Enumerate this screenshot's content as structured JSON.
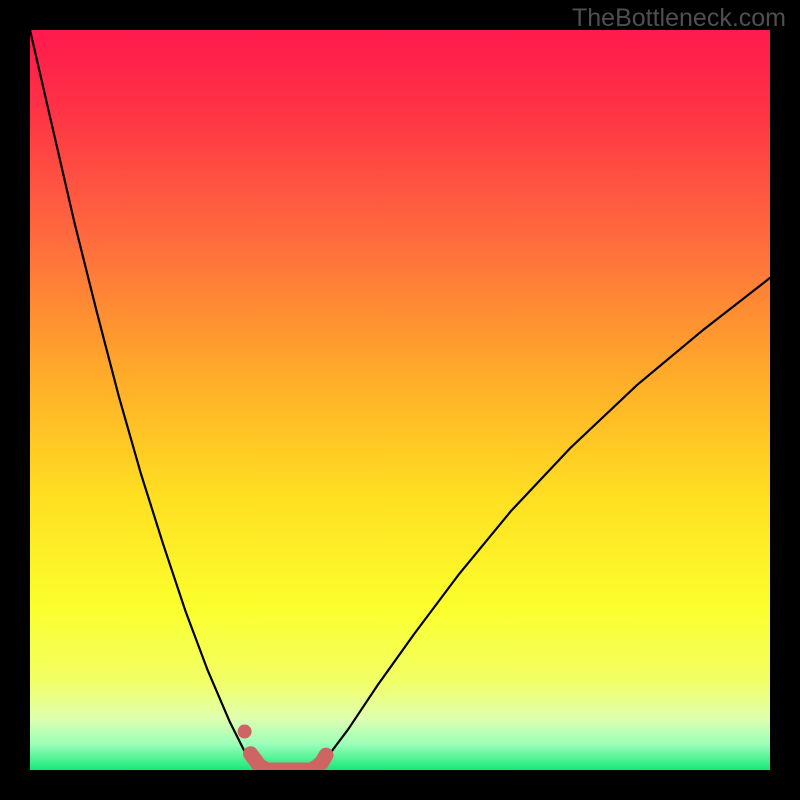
{
  "watermark": "TheBottleneck.com",
  "colors": {
    "frame": "#000000",
    "grad_top": "#ff1a4d",
    "grad_upper_mid": "#ff653f",
    "grad_mid": "#ffd321",
    "grad_lower": "#f8ff33",
    "grad_band_pale": "#e6ffb3",
    "grad_bottom": "#1cf07c",
    "curve": "#000000",
    "marker": "#cf6464"
  },
  "chart_data": {
    "type": "line",
    "title": "",
    "xlabel": "",
    "ylabel": "",
    "xlim": [
      0,
      1
    ],
    "ylim": [
      0,
      1
    ],
    "note": "Axes have no visible tick labels; x normalized 0-1 left→right across the gradient area, y normalized 0-1 bottom→top. Values are read off the rendered curve.",
    "series": [
      {
        "name": "left-branch",
        "x": [
          0.0,
          0.03,
          0.06,
          0.09,
          0.12,
          0.15,
          0.18,
          0.21,
          0.24,
          0.27,
          0.29,
          0.305,
          0.32
        ],
        "y": [
          1.0,
          0.87,
          0.74,
          0.62,
          0.505,
          0.4,
          0.305,
          0.215,
          0.135,
          0.065,
          0.025,
          0.01,
          0.0
        ]
      },
      {
        "name": "right-branch",
        "x": [
          0.38,
          0.4,
          0.43,
          0.47,
          0.52,
          0.58,
          0.65,
          0.73,
          0.82,
          0.91,
          1.0
        ],
        "y": [
          0.0,
          0.015,
          0.055,
          0.115,
          0.185,
          0.265,
          0.35,
          0.435,
          0.52,
          0.595,
          0.665
        ]
      }
    ],
    "markers": {
      "name": "valley-markers",
      "color": "#cf6464",
      "points_x": [
        0.298,
        0.31,
        0.32,
        0.332,
        0.344,
        0.356,
        0.368,
        0.38,
        0.387,
        0.394,
        0.4
      ],
      "points_y": [
        0.022,
        0.006,
        0.0,
        0.0,
        0.0,
        0.0,
        0.0,
        0.0,
        0.004,
        0.01,
        0.02
      ],
      "isolated_point": {
        "x": 0.29,
        "y": 0.052
      }
    }
  }
}
